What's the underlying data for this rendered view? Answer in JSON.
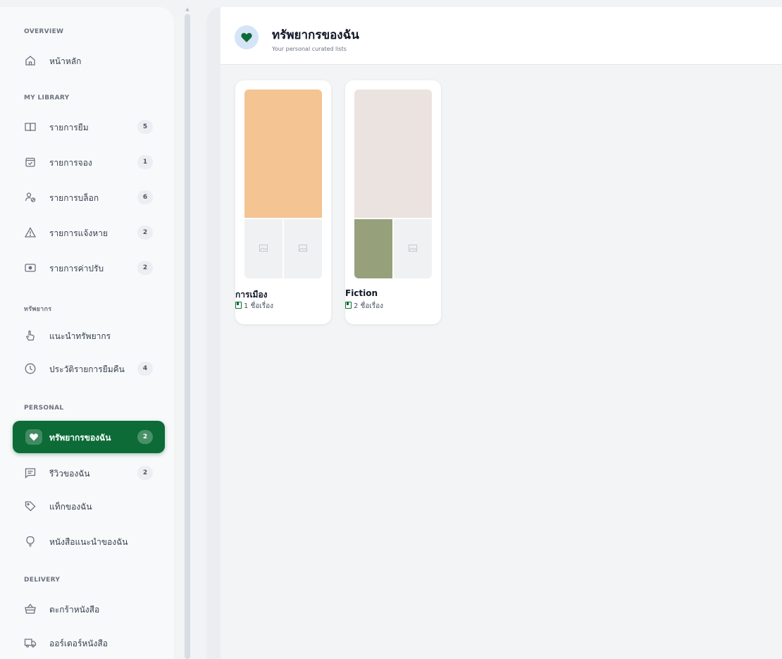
{
  "sidebar": {
    "sections": {
      "overview": "OVERVIEW",
      "library": "MY LIBRARY",
      "resources": "ทรัพยากร",
      "personal": "PERSONAL",
      "delivery": "DELIVERY"
    },
    "items": [
      {
        "label": "หน้าหลัก",
        "icon": "home-icon"
      },
      {
        "label": "รายการยืม",
        "icon": "book-icon",
        "badge": "5"
      },
      {
        "label": "รายการจอง",
        "icon": "calendar-check-icon",
        "badge": "1"
      },
      {
        "label": "รายการบล็อก",
        "icon": "user-block-icon",
        "badge": "6"
      },
      {
        "label": "รายการแจ้งหาย",
        "icon": "warning-icon",
        "badge": "2"
      },
      {
        "label": "รายการค่าปรับ",
        "icon": "money-icon",
        "badge": "2"
      },
      {
        "label": "แนะนำทรัพยากร",
        "icon": "hand-pointer-icon"
      },
      {
        "label": "ประวัติรายการยืมคืน",
        "icon": "clock-icon",
        "badge": "4"
      },
      {
        "label": "ทรัพยากรของฉัน",
        "icon": "heart-icon",
        "badge": "2",
        "active": true
      },
      {
        "label": "รีวิวของฉัน",
        "icon": "comment-icon",
        "badge": "2"
      },
      {
        "label": "แท็กของฉัน",
        "icon": "tag-icon"
      },
      {
        "label": "หนังสือแนะนำของฉัน",
        "icon": "lightbulb-icon"
      },
      {
        "label": "ตะกร้าหนังสือ",
        "icon": "basket-icon"
      },
      {
        "label": "ออร์เดอร์หนังสือ",
        "icon": "truck-icon"
      }
    ]
  },
  "header": {
    "title": "ทรัพยากรของฉัน",
    "subtitle": "Your personal curated lists",
    "icon": "heart-icon"
  },
  "collections": [
    {
      "name": "การเมือง",
      "count": "1 ชื่อเรื่อง",
      "cover_color": "#f4c493",
      "thumb_left": "placeholder",
      "thumb_right": "placeholder"
    },
    {
      "name": "Fiction",
      "count": "2 ชื่อเรื่อง",
      "cover_color": "#ebe3df",
      "thumb_left_color": "#96a17c",
      "thumb_right": "placeholder"
    }
  ],
  "colors": {
    "accent": "#0c6b37",
    "header_icon_bg": "#d6e4f7"
  }
}
